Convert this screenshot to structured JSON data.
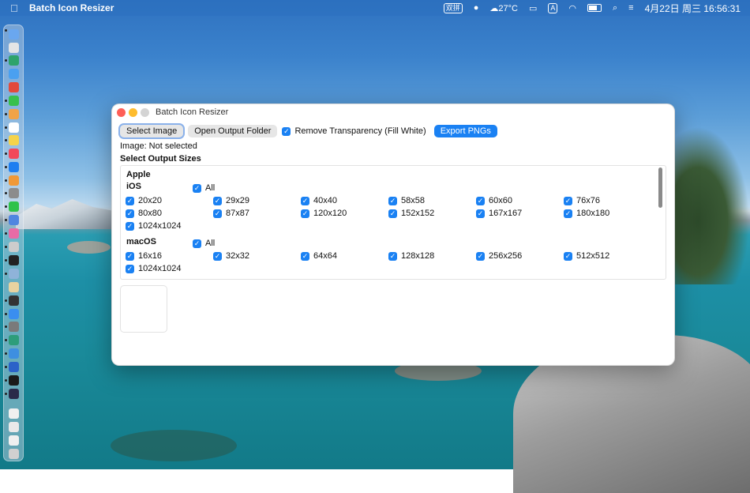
{
  "menubar": {
    "app_name": "Batch Icon Resizer",
    "input_method": "双拼",
    "weather": "☁27°C",
    "keyboard": "A",
    "battery_level": 0.72,
    "datetime": "4月22日 周三  16:56:31"
  },
  "window": {
    "title": "Batch Icon Resizer",
    "toolbar": {
      "select_image": "Select Image",
      "open_output": "Open Output Folder",
      "remove_transparency": "Remove Transparency (Fill White)",
      "export": "Export PNGs"
    },
    "status": "Image: Not selected",
    "section_title": "Select Output Sizes",
    "group": "Apple",
    "ios": {
      "label": "iOS",
      "all": "All",
      "sizes": [
        "20x20",
        "29x29",
        "40x40",
        "58x58",
        "60x60",
        "76x76",
        "80x80",
        "87x87",
        "120x120",
        "152x152",
        "167x167",
        "180x180",
        "1024x1024"
      ]
    },
    "macos": {
      "label": "macOS",
      "all": "All",
      "sizes": [
        "16x16",
        "32x32",
        "64x64",
        "128x128",
        "256x256",
        "512x512",
        "1024x1024"
      ]
    }
  },
  "dock": {
    "icons": [
      "finder-icon",
      "launchpad-icon",
      "edge-icon",
      "safari-icon",
      "chrome-icon",
      "messages-icon",
      "photos-icon",
      "calendar-icon",
      "notes-icon",
      "music-icon",
      "app-store-icon",
      "books-icon",
      "settings-icon",
      "wechat-icon",
      "xcode-icon",
      "photos-alt-icon",
      "disk-icon",
      "terminal-icon",
      "preview-icon",
      "contacts-icon",
      "terminal-dark-icon",
      "app-store-alt-icon",
      "settings-alt-icon",
      "edge-alt-icon",
      "safari-alt-icon",
      "word-icon",
      "terminal-alt-icon",
      "monitor-icon",
      "document-icon",
      "mail-icon",
      "folder-icon",
      "trash-icon"
    ],
    "colors": [
      "#6aa7ef",
      "#e5e5e5",
      "#2ea36b",
      "#4aa0f0",
      "#e34a3b",
      "#38c04d",
      "#f0a347",
      "#fff",
      "#f5d34b",
      "#f2485a",
      "#1e7ef0",
      "#f09938",
      "#8c8c8c",
      "#2ec24a",
      "#4f86e0",
      "#e86ba6",
      "#cccccc",
      "#222222",
      "#8fb3d9",
      "#e8d3a0",
      "#333333",
      "#3a8ef0",
      "#7a7a7a",
      "#2d9d7a",
      "#3e8fe0",
      "#2b62c8",
      "#1a1a1a",
      "#2a2a4a",
      "#f0f0f0",
      "#e9e9e9",
      "#f0f0f0",
      "#d0d0d0"
    ]
  }
}
